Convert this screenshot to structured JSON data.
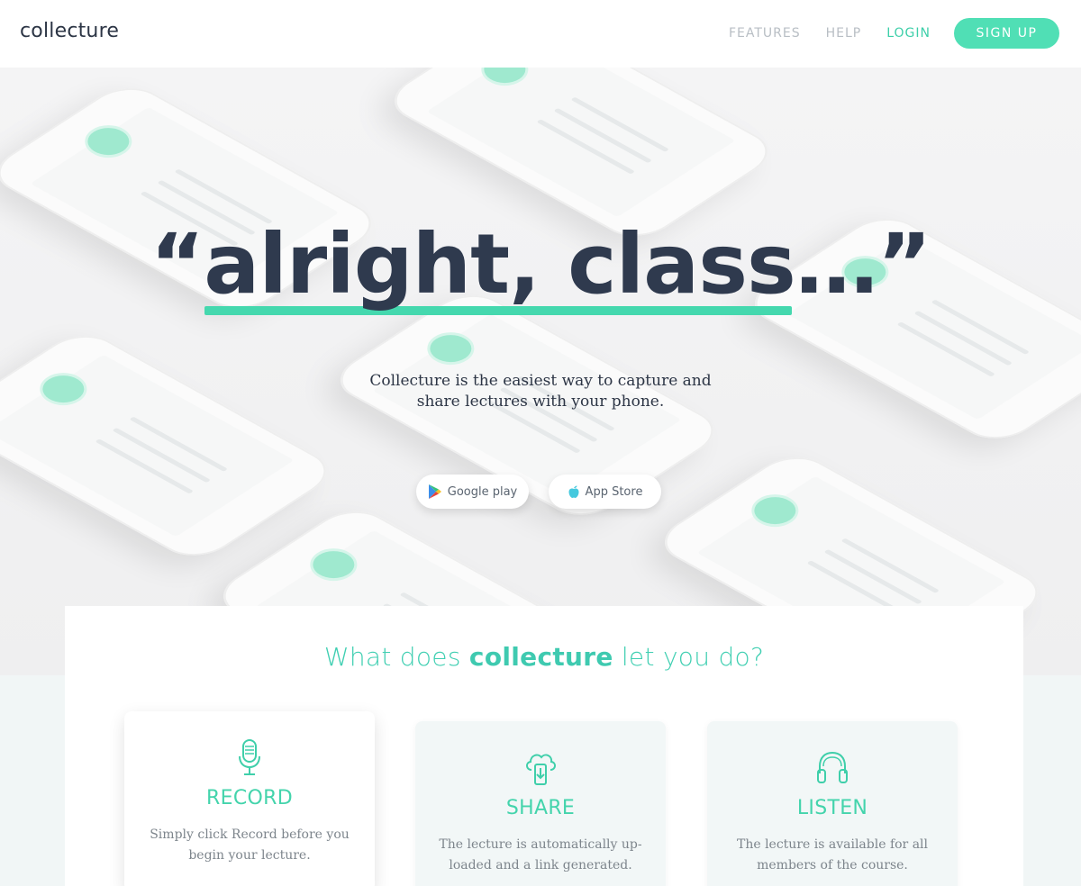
{
  "header": {
    "logo": "collecture",
    "nav": {
      "features": "FEATURES",
      "help": "HELP",
      "login": "LOGIN",
      "signup": "SIGN UP"
    }
  },
  "hero": {
    "headline": "“alright, class…”",
    "tagline": "Collecture is the easiest way to capture and share lectures with your phone.",
    "buttons": {
      "google_play": "Google play",
      "app_store": "App Store"
    }
  },
  "features": {
    "title_prefix": "What does ",
    "title_brand": "collecture",
    "title_suffix": " let you do?",
    "cards": [
      {
        "icon": "microphone-icon",
        "title": "RECORD",
        "desc": "Simply click Record before you begin your lecture."
      },
      {
        "icon": "cloud-upload-icon",
        "title": "SHARE",
        "desc": "The lecture is automatically up-loaded and a link generated."
      },
      {
        "icon": "headphones-icon",
        "title": "LISTEN",
        "desc": "The lecture is available for all members of the course."
      }
    ]
  },
  "colors": {
    "accent": "#50dfb5",
    "text_dark": "#2f3a4e",
    "teal_text": "#40cfb2"
  }
}
